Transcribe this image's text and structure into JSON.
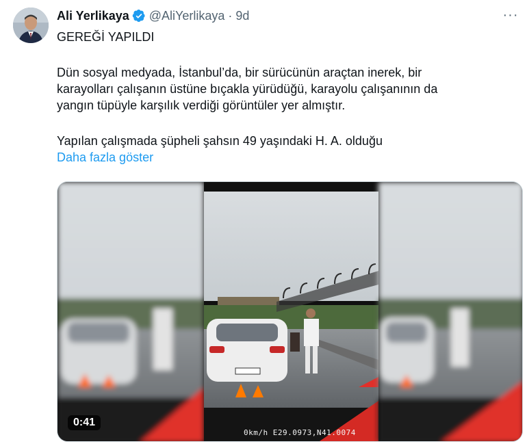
{
  "author": {
    "name": "Ali Yerlikaya",
    "handle": "@AliYerlikaya",
    "separator": "·",
    "time": "9d",
    "verified_icon": "verified-badge-icon",
    "verified_color": "#1d9bf0"
  },
  "menu": {
    "icon": "more-options-icon",
    "glyph": "···"
  },
  "tweet": {
    "line1": "GEREĞİ YAPILDI",
    "para1_line1": "Dün sosyal medyada, İstanbul’da, bir sürücünün araçtan inerek, bir",
    "para1_line2": "karayolları çalışanın üstüne bıçakla yürüdüğü, karayolu çalışanının da",
    "para1_line3": "yangın tüpüyle karşılık verdiği görüntüler yer almıştır.",
    "para2_line1": "Yapılan çalışmada şüpheli şahsın 49 yaşındaki H. A. olduğu",
    "show_more": "Daha fazla göster",
    "link_color": "#1d9bf0"
  },
  "media": {
    "duration": "0:41",
    "overlay": "0km/h E29.0973,N41.0074"
  }
}
